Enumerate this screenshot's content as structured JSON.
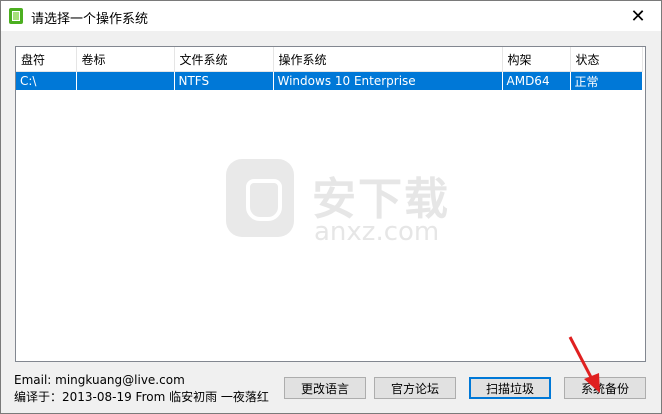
{
  "window": {
    "title": "请选择一个操作系统",
    "close_glyph": "✕"
  },
  "list": {
    "columns": [
      "盘符",
      "卷标",
      "文件系统",
      "操作系统",
      "构架",
      "状态"
    ],
    "rows": [
      {
        "drive": "C:\\",
        "label": "",
        "fs": "NTFS",
        "os": "Windows 10 Enterprise",
        "arch": "AMD64",
        "status": "正常",
        "selected": true
      }
    ]
  },
  "watermark": {
    "brand": "安下载",
    "domain": "anxz.com"
  },
  "footer": {
    "email": "Email: mingkuang@live.com",
    "compiled": "编译于：2013-08-19 From 临安初雨 一夜落红"
  },
  "buttons": {
    "language": "更改语言",
    "forum": "官方论坛",
    "scan": "扫描垃圾",
    "backup": "系统备份"
  },
  "colors": {
    "selection": "#0078d7",
    "arrow": "#e02020"
  }
}
